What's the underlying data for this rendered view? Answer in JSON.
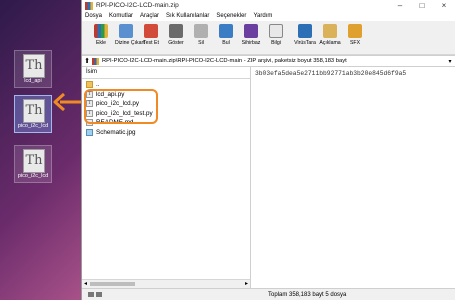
{
  "desktop": {
    "icons": [
      {
        "label": "lcd_api"
      },
      {
        "label": "pico_i2c_lcd"
      },
      {
        "label": "pico_i2c_lcd"
      }
    ]
  },
  "window": {
    "title": "RPI-PICO-I2C-LCD-main.zip",
    "menu": [
      "Dosya",
      "Komutlar",
      "Araçlar",
      "Sık Kullanılanlar",
      "Seçenekler",
      "Yardım"
    ],
    "toolbar": [
      "Ekle",
      "Dizine Çıkart",
      "Test Et",
      "Göster",
      "Sil",
      "Bul",
      "Sihirbaz",
      "Bilgi",
      "VirüsTara",
      "Açıklama",
      "SFX"
    ],
    "address": "RPI-PICO-I2C-LCD-main.zip\\RPI-PICO-I2C-LCD-main - ZIP arşivi, paketsiz boyut 358,183 bayt",
    "column_name": "İsim",
    "files": [
      {
        "name": "..",
        "type": "folder"
      },
      {
        "name": "lcd_api.py",
        "type": "py"
      },
      {
        "name": "pico_i2c_lcd.py",
        "type": "py"
      },
      {
        "name": "pico_i2c_lcd_test.py",
        "type": "py"
      },
      {
        "name": "README.md",
        "type": "doc"
      },
      {
        "name": "Schematic.jpg",
        "type": "img"
      }
    ],
    "comment": "3b03efa5dea5e2711bb92771ab3b20e845d6f9a5",
    "status": "Toplam 358,183 bayt 5 dosya"
  }
}
